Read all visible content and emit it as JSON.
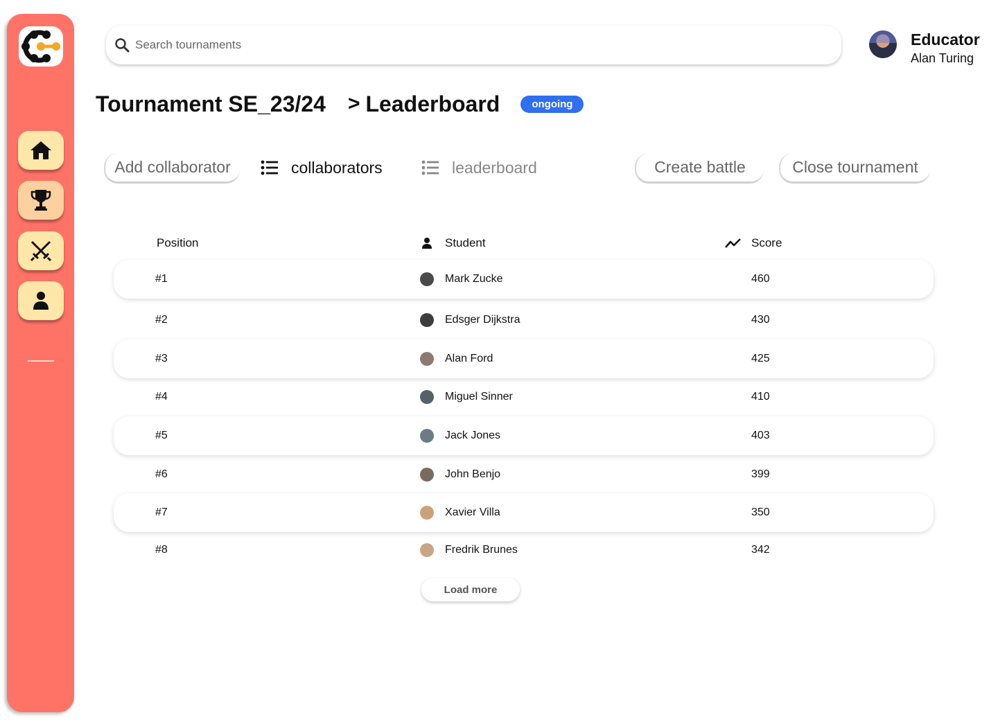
{
  "header": {
    "search_placeholder": "Search tournaments",
    "user_role": "Educator",
    "user_name": "Alan Turing"
  },
  "page": {
    "title": "Tournament SE_23/24",
    "separator": ">",
    "subtitle": "Leaderboard",
    "status_badge": "ongoing"
  },
  "actions": {
    "add_collaborator": "Add collaborator",
    "collaborators_tab": "collaborators",
    "leaderboard_tab": "leaderboard",
    "create_battle": "Create battle",
    "close_tournament": "Close tournament"
  },
  "table": {
    "columns": {
      "position": "Position",
      "student": "Student",
      "score": "Score"
    },
    "rows": [
      {
        "position": "#1",
        "student": "Mark Zucke",
        "score": "460",
        "avatar_color": "#4a4a4a"
      },
      {
        "position": "#2",
        "student": "Edsger Dijkstra",
        "score": "430",
        "avatar_color": "#3d3d3d"
      },
      {
        "position": "#3",
        "student": "Alan Ford",
        "score": "425",
        "avatar_color": "#8c7a70"
      },
      {
        "position": "#4",
        "student": "Miguel Sinner",
        "score": "410",
        "avatar_color": "#55616a"
      },
      {
        "position": "#5",
        "student": "Jack Jones",
        "score": "403",
        "avatar_color": "#6b7c86"
      },
      {
        "position": "#6",
        "student": "John Benjo",
        "score": "399",
        "avatar_color": "#7a6a5e"
      },
      {
        "position": "#7",
        "student": "Xavier Villa",
        "score": "350",
        "avatar_color": "#c9a27c"
      },
      {
        "position": "#8",
        "student": "Fredrik Brunes",
        "score": "342",
        "avatar_color": "#c7a585"
      }
    ],
    "load_more": "Load more"
  },
  "colors": {
    "sidebar": "#ff7367",
    "nav_button": "#fee7a8",
    "badge": "#2f6ff0",
    "logo_accent": "#f5a623"
  },
  "icons": {
    "nav": [
      "home-icon",
      "trophy-icon",
      "crossed-swords-icon",
      "user-icon"
    ],
    "search": "search-icon",
    "student_header": "person-icon",
    "score_header": "trend-line-icon",
    "tab": "list-icon"
  }
}
